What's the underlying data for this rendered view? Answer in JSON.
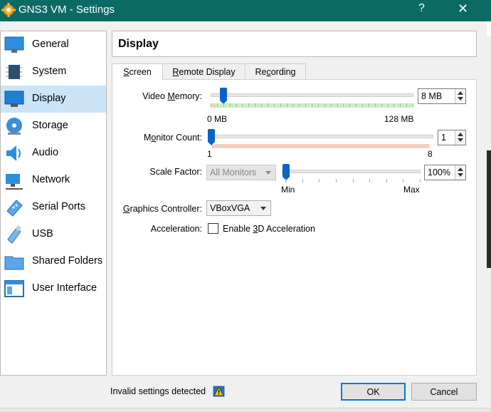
{
  "window": {
    "title": "GNS3 VM - Settings",
    "help": "?",
    "close": "✕"
  },
  "sidebar": {
    "items": [
      {
        "label": "General",
        "icon": "general-monitor-icon"
      },
      {
        "label": "System",
        "icon": "chip-icon"
      },
      {
        "label": "Display",
        "icon": "display-icon",
        "selected": true
      },
      {
        "label": "Storage",
        "icon": "disk-icon"
      },
      {
        "label": "Audio",
        "icon": "speaker-icon"
      },
      {
        "label": "Network",
        "icon": "network-icon"
      },
      {
        "label": "Serial Ports",
        "icon": "serial-port-icon"
      },
      {
        "label": "USB",
        "icon": "usb-icon"
      },
      {
        "label": "Shared Folders",
        "icon": "folder-icon"
      },
      {
        "label": "User Interface",
        "icon": "window-icon"
      }
    ]
  },
  "page": {
    "title": "Display"
  },
  "tabs": [
    {
      "label": "Screen",
      "active": true
    },
    {
      "label": "Remote Display"
    },
    {
      "label": "Recording"
    }
  ],
  "screen": {
    "video_memory": {
      "label": "Video Memory:",
      "value": "8 MB",
      "min_label": "0 MB",
      "max_label": "128 MB",
      "fraction": 0.062
    },
    "monitor_count": {
      "label": "Monitor Count:",
      "value": "1",
      "min_label": "1",
      "max_label": "8",
      "fraction": 0.0
    },
    "scale_factor": {
      "label": "Scale Factor:",
      "combo": "All Monitors",
      "value": "100%",
      "min_label": "Min",
      "max_label": "Max",
      "fraction": 0.0
    },
    "graphics_controller": {
      "label": "Graphics Controller:",
      "value": "VBoxVGA"
    },
    "acceleration": {
      "label": "Acceleration:",
      "checkbox_label": "Enable 3D Acceleration",
      "checked": false
    }
  },
  "footer": {
    "message": "Invalid settings detected",
    "ok": "OK",
    "cancel": "Cancel"
  },
  "colors": {
    "titlebar": "#0b6a64",
    "selection": "#cce4f7",
    "slider": "#0a63c9",
    "range_green": "#c9efc2",
    "range_red": "#f7cfc0"
  }
}
